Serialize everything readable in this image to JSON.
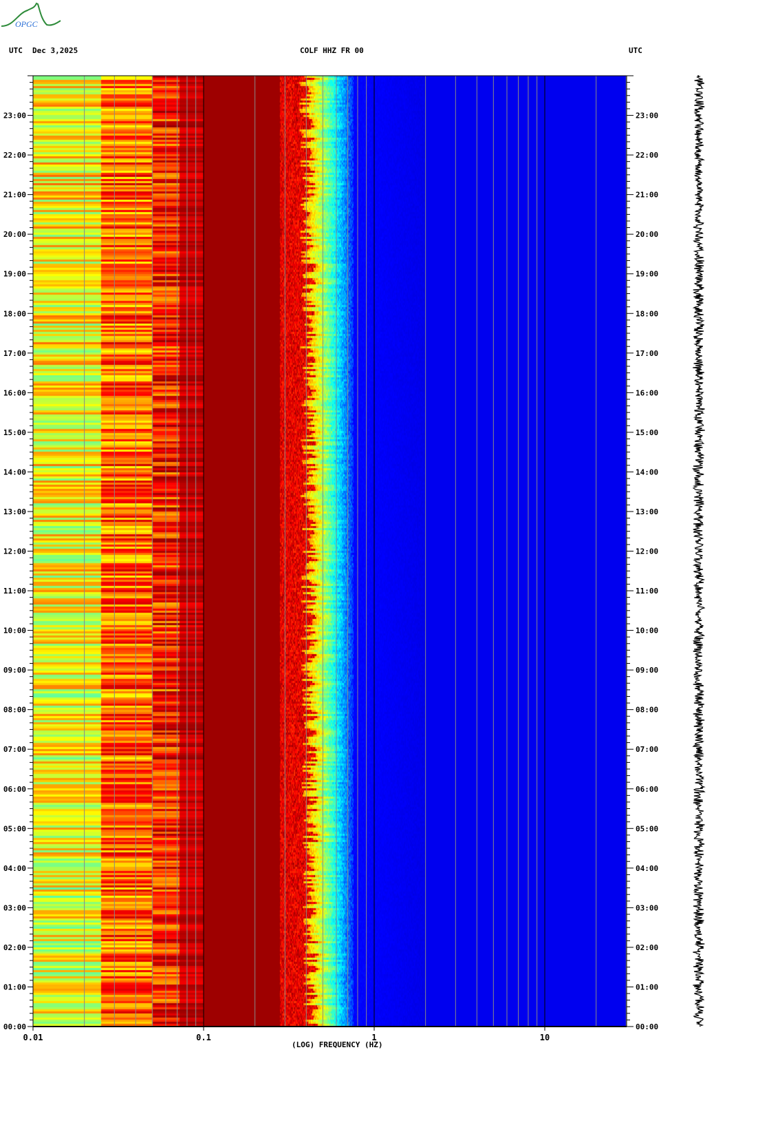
{
  "header": {
    "logo_text": "OPGC",
    "tz_left": "UTC",
    "date": "Dec 3,2025",
    "station": "COLF HHZ FR 00",
    "tz_right": "UTC"
  },
  "chart_data": {
    "type": "heatmap",
    "title": "COLF HHZ FR 00",
    "xlabel": "(LOG) FREQUENCY (HZ)",
    "ylabel": "UTC",
    "xscale": "log",
    "xlim": [
      0.01,
      30
    ],
    "ylim_hours": [
      0,
      24
    ],
    "x_ticks": [
      "0.01",
      "0.1",
      "1",
      "10"
    ],
    "x_tick_values": [
      0.01,
      0.1,
      1,
      10
    ],
    "y_ticks": [
      "00:00",
      "01:00",
      "02:00",
      "03:00",
      "04:00",
      "05:00",
      "06:00",
      "07:00",
      "08:00",
      "09:00",
      "10:00",
      "11:00",
      "12:00",
      "13:00",
      "14:00",
      "15:00",
      "16:00",
      "17:00",
      "18:00",
      "19:00",
      "20:00",
      "21:00",
      "22:00",
      "23:00"
    ],
    "colormap": "jet",
    "bands": [
      {
        "fmin": 0.01,
        "fmax": 0.025,
        "level": "moderate (cyan-yellow)"
      },
      {
        "fmin": 0.025,
        "fmax": 0.07,
        "level": "high (yellow-red)"
      },
      {
        "fmin": 0.07,
        "fmax": 0.3,
        "level": "very high (dark red, microseism)"
      },
      {
        "fmin": 0.3,
        "fmax": 0.6,
        "level": "decreasing (yellow-cyan-blue)"
      },
      {
        "fmin": 0.6,
        "fmax": 30,
        "level": "low (dark blue)"
      }
    ],
    "side_trace": "seismogram"
  }
}
